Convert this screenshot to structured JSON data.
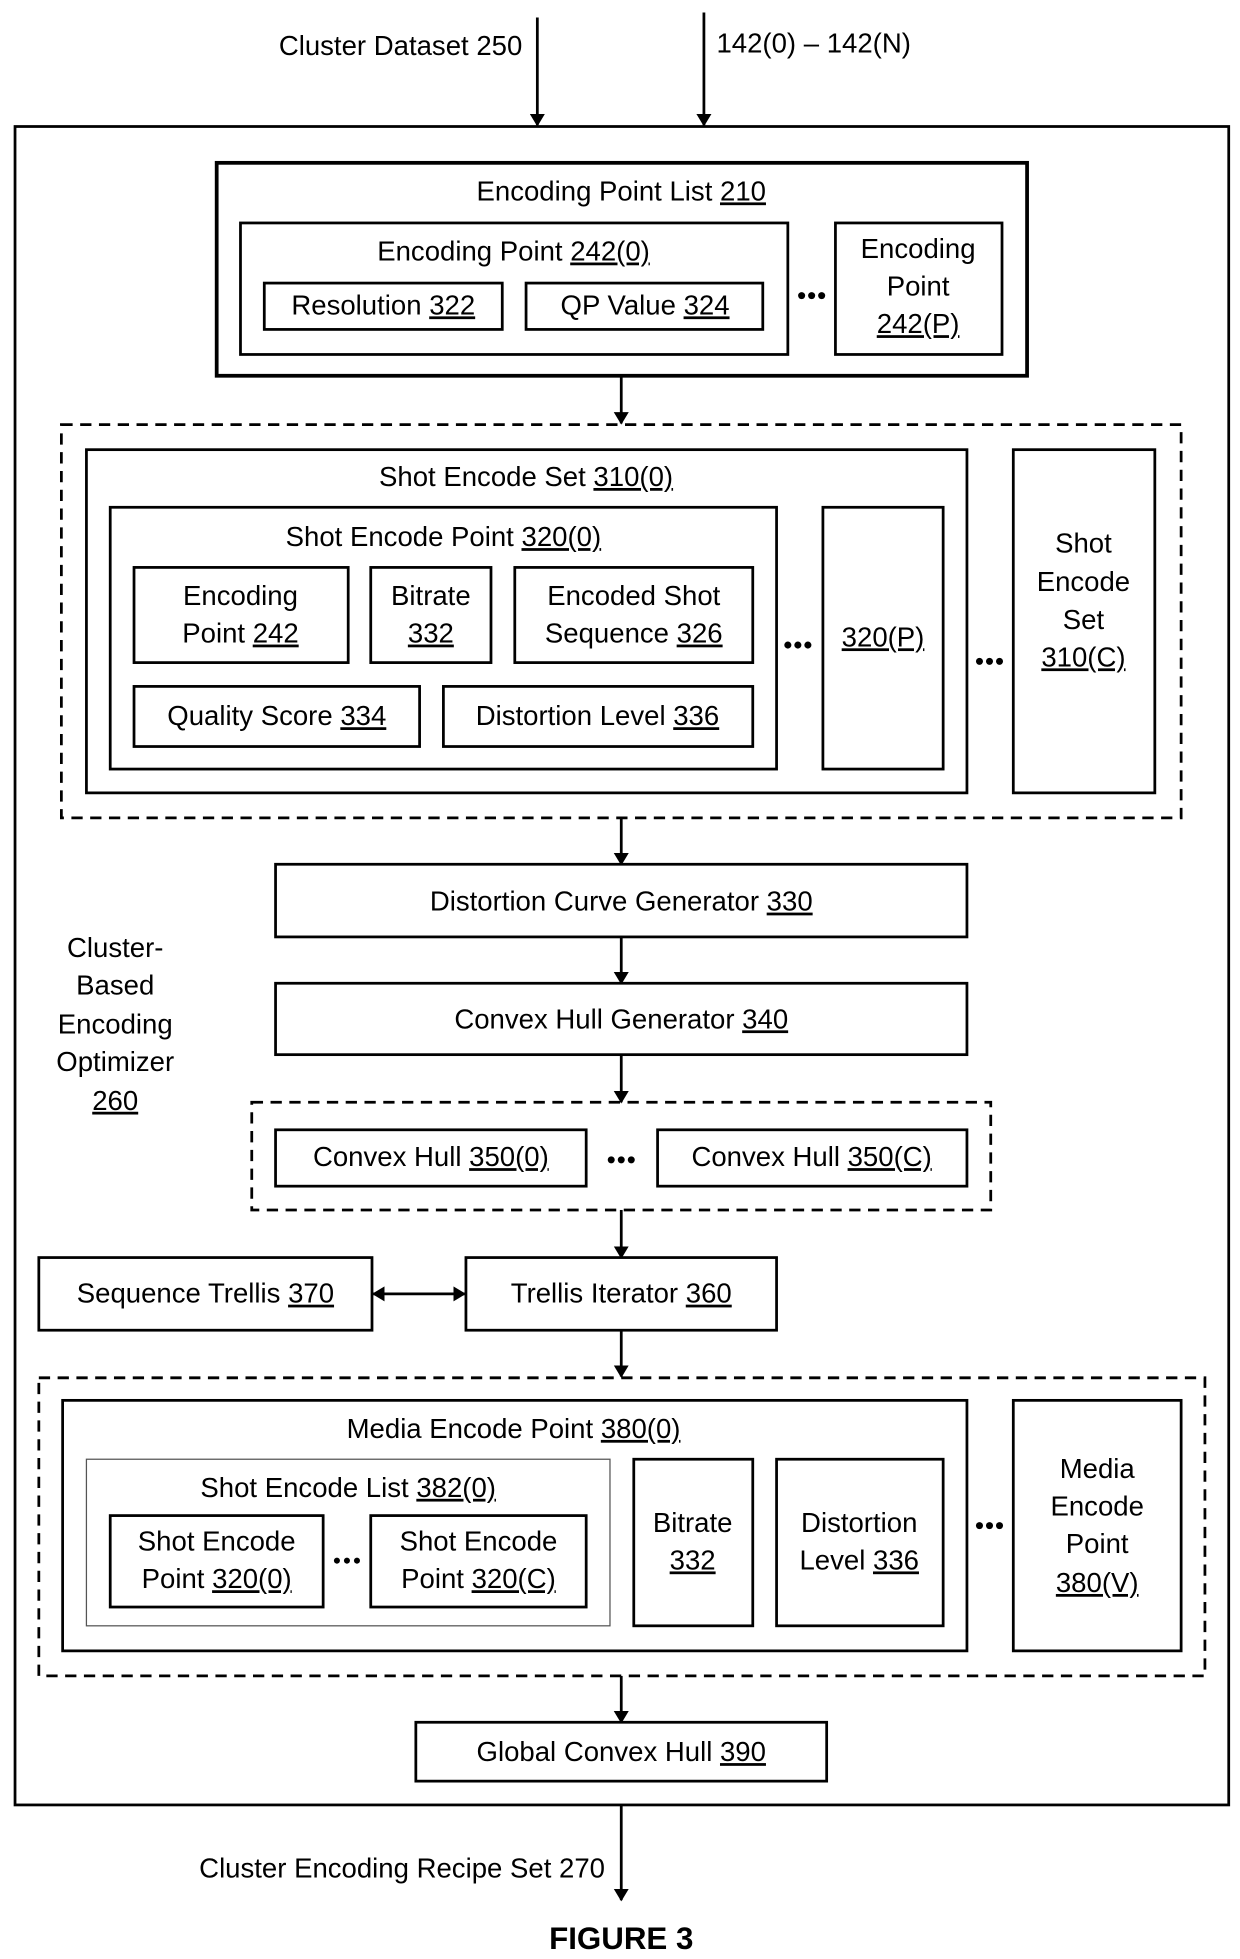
{
  "inputs": {
    "cluster_dataset": "Cluster Dataset 250",
    "shots": "142(0) – 142(N)"
  },
  "optimizer": {
    "lines": [
      "Cluster-",
      "Based",
      "Encoding",
      "Optimizer"
    ],
    "ref": "260"
  },
  "encoding_point_list": {
    "title": "Encoding Point List ",
    "ref": "210",
    "first_point": {
      "title": "Encoding Point ",
      "ref": "242(0)"
    },
    "resolution": {
      "label": "Resolution ",
      "ref": "322"
    },
    "qp_value": {
      "label": "QP Value ",
      "ref": "324"
    },
    "last_point": {
      "lines": [
        "Encoding",
        "Point"
      ],
      "ref": "242(P)"
    }
  },
  "shot_encode_sets": {
    "first_set": {
      "title": "Shot Encode Set ",
      "ref": "310(0)"
    },
    "first_point": {
      "title": "Shot Encode Point ",
      "ref": "320(0)"
    },
    "encoding_point": {
      "line1": "Encoding",
      "line2": "Point ",
      "ref": "242"
    },
    "bitrate": {
      "line1": "Bitrate",
      "ref": "332"
    },
    "encoded_shot_sequence": {
      "line1": "Encoded Shot",
      "line2": "Sequence ",
      "ref": "326"
    },
    "quality_score": {
      "label": "Quality Score ",
      "ref": "334"
    },
    "distortion_level": {
      "label": "Distortion Level ",
      "ref": "336"
    },
    "last_point": {
      "ref": "320(P)"
    },
    "last_set": {
      "lines": [
        "Shot",
        "Encode",
        "Set"
      ],
      "ref": "310(C)"
    }
  },
  "distortion_curve_generator": {
    "label": "Distortion Curve Generator ",
    "ref": "330"
  },
  "convex_hull_generator": {
    "label": "Convex Hull Generator ",
    "ref": "340"
  },
  "convex_hulls": {
    "first": {
      "label": "Convex Hull ",
      "ref": "350(0)"
    },
    "last": {
      "label": "Convex Hull ",
      "ref": "350(C)"
    }
  },
  "sequence_trellis": {
    "label": "Sequence Trellis ",
    "ref": "370"
  },
  "trellis_iterator": {
    "label": "Trellis Iterator ",
    "ref": "360"
  },
  "media_encode_points": {
    "first": {
      "title": "Media Encode Point ",
      "ref": "380(0)"
    },
    "shot_encode_list": {
      "title": "Shot Encode List ",
      "ref": "382(0)"
    },
    "shot_point_first": {
      "line1": "Shot Encode",
      "line2": "Point ",
      "ref": "320(0)"
    },
    "shot_point_last": {
      "line1": "Shot Encode",
      "line2": "Point ",
      "ref": "320(C)"
    },
    "bitrate": {
      "line1": "Bitrate",
      "ref": "332"
    },
    "distortion_level": {
      "line1": "Distortion",
      "line2": "Level ",
      "ref": "336"
    },
    "last": {
      "lines": [
        "Media",
        "Encode",
        "Point"
      ],
      "ref": "380(V)"
    }
  },
  "global_convex_hull": {
    "label": "Global Convex Hull ",
    "ref": "390"
  },
  "output": {
    "label": "Cluster Encoding Recipe Set 270"
  },
  "figure_label": "FIGURE 3"
}
